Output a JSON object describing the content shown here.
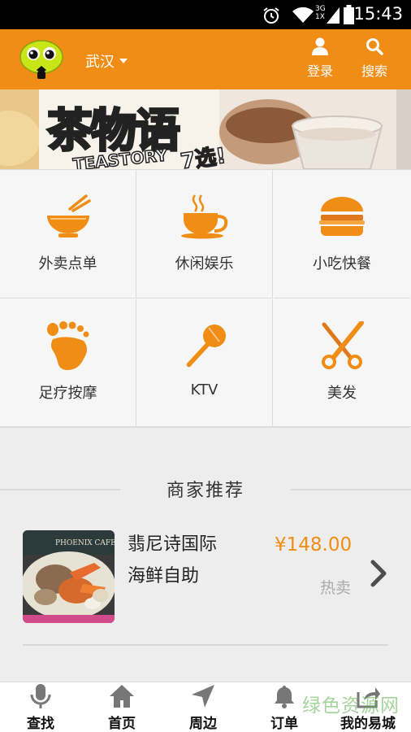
{
  "status_bar": {
    "time": "15:43",
    "icons": [
      "alarm-icon",
      "wifi-icon",
      "signal-icon",
      "battery-icon"
    ],
    "network_label_top": "3G",
    "network_label_bottom": "1X"
  },
  "header": {
    "city": "武汉",
    "login_label": "登录",
    "search_label": "搜索",
    "accent_color": "#f08d15"
  },
  "banner": {
    "brand_cn": "茶物语",
    "brand_en": "TEASTORY",
    "slogan": "7选!"
  },
  "categories": [
    {
      "label": "外卖点单",
      "icon": "bowl-chopsticks-icon"
    },
    {
      "label": "休闲娱乐",
      "icon": "coffee-cup-icon"
    },
    {
      "label": "小吃快餐",
      "icon": "burger-icon"
    },
    {
      "label": "足疗按摩",
      "icon": "foot-icon"
    },
    {
      "label": "KTV",
      "icon": "microphone-icon"
    },
    {
      "label": "美发",
      "icon": "scissors-icon"
    }
  ],
  "section": {
    "title": "商家推荐"
  },
  "merchant": {
    "name": "翡尼诗国际海鲜自助",
    "price": "¥148.00",
    "tag": "热卖",
    "image_sign": "PHOENIX CAFE"
  },
  "bottom_nav": [
    {
      "label": "查找",
      "icon": "microphone-icon"
    },
    {
      "label": "首页",
      "icon": "home-icon"
    },
    {
      "label": "周边",
      "icon": "location-arrow-icon"
    },
    {
      "label": "订单",
      "icon": "bell-icon"
    },
    {
      "label": "我的易城",
      "icon": "share-box-icon"
    }
  ],
  "watermark": "绿色资源网"
}
